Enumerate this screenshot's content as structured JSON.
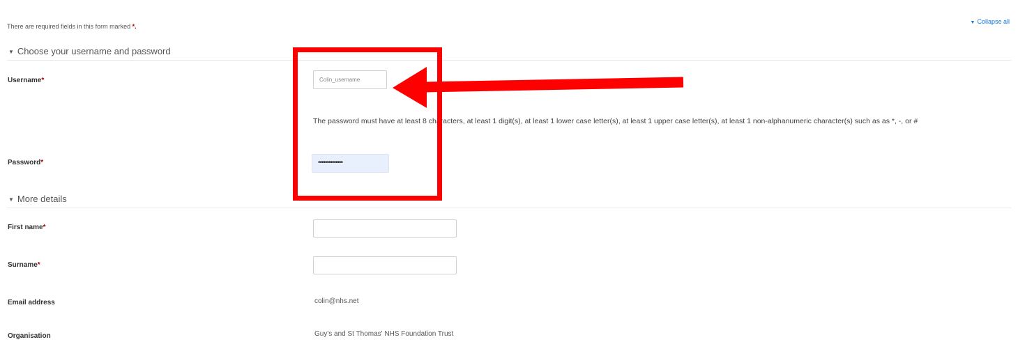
{
  "header": {
    "collapse_all_label": "Collapse all",
    "required_note": "There are required fields in this form marked",
    "required_mark": "*."
  },
  "sections": {
    "account": {
      "title": "Choose your username and password"
    },
    "details": {
      "title": "More details"
    }
  },
  "fields": {
    "username": {
      "label": "Username",
      "value": "Colin_username"
    },
    "password_help": "The password must have at least 8 characters, at least 1 digit(s), at least 1 lower case letter(s), at least 1 upper case letter(s), at least 1 non-alphanumeric character(s) such as as *, -, or #",
    "password": {
      "label": "Password",
      "value": "••••••••••••••"
    },
    "first_name": {
      "label": "First name",
      "value": ""
    },
    "surname": {
      "label": "Surname",
      "value": ""
    },
    "email": {
      "label": "Email address",
      "value": "colin@nhs.net"
    },
    "organisation": {
      "label": "Organisation",
      "value": "Guy's and St Thomas' NHS Foundation Trust"
    }
  },
  "required_star": "*",
  "annotation": {
    "highlight_color": "#ff0000"
  }
}
